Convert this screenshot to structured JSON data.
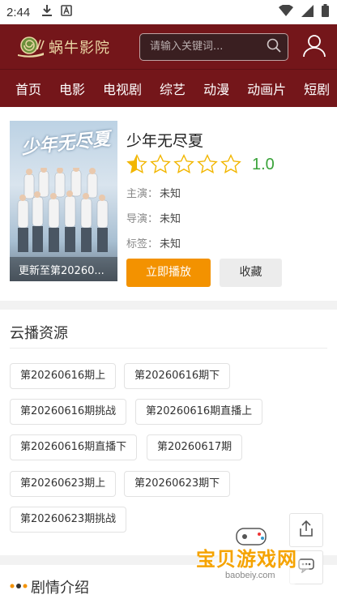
{
  "status_bar": {
    "time": "2:44"
  },
  "header": {
    "logo_text": "蜗牛影院",
    "search_placeholder": "请输入关键词..."
  },
  "nav": [
    "首页",
    "电影",
    "电视剧",
    "综艺",
    "动漫",
    "动画片",
    "短剧"
  ],
  "detail": {
    "title": "少年无尽夏",
    "rating": {
      "score": "1.0",
      "stars_filled_fraction": 0.5,
      "max_stars": 5
    },
    "starring_label": "主演：",
    "starring_value": "未知",
    "director_label": "导演：",
    "director_value": "未知",
    "tags_label": "标签：",
    "tags_value": "未知",
    "play_label": "立即播放",
    "fav_label": "收藏",
    "poster_title": "少年无尽夏",
    "poster_caption": "更新至第20260..."
  },
  "sources": {
    "title": "云播资源",
    "episodes": [
      "第20260616期上",
      "第20260616期下",
      "第20260616期挑战",
      "第20260616期直播上",
      "第20260616期直播下",
      "第20260617期",
      "第20260623期上",
      "第20260623期下",
      "第20260623期挑战"
    ]
  },
  "plot": {
    "title": "剧情介绍"
  },
  "watermark": {
    "text": "宝贝游戏网",
    "url": "baobeiy.com"
  },
  "colors": {
    "header_bg": "#74161a",
    "play_button": "#f39200",
    "score": "#3aa33a",
    "star": "#f2b600"
  }
}
